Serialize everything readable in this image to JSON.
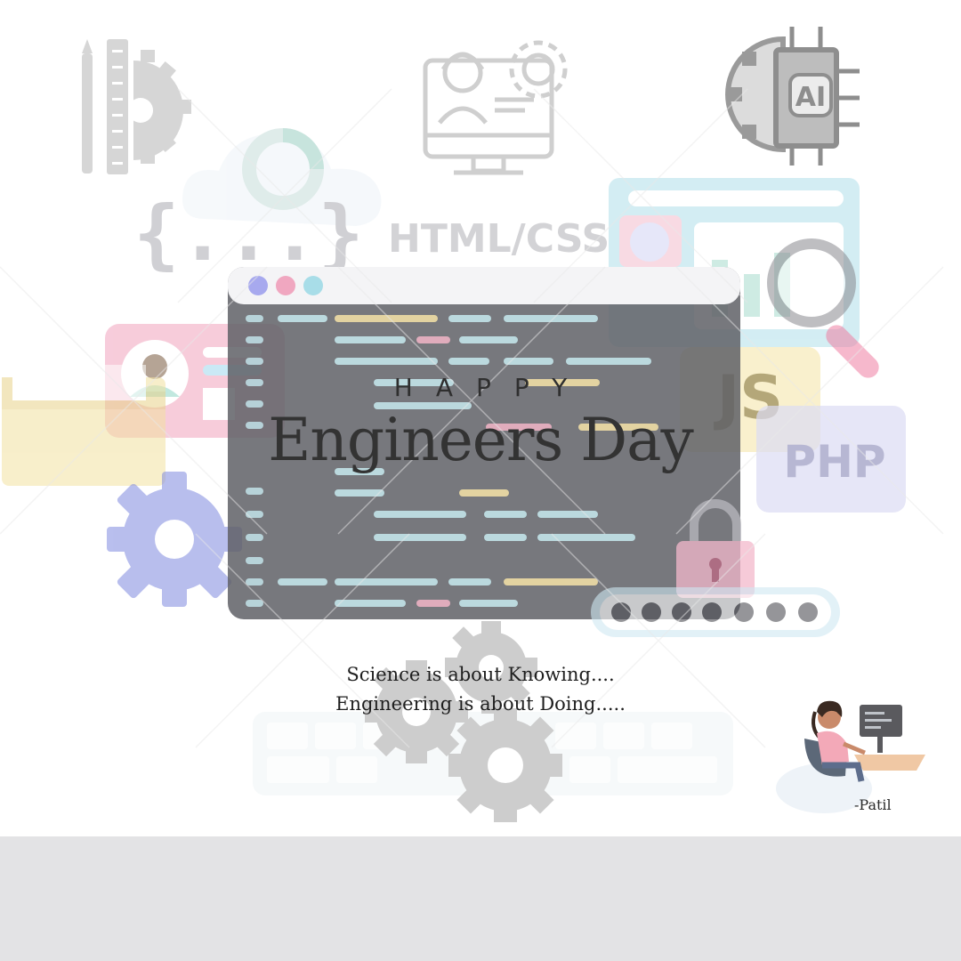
{
  "poster": {
    "greeting": "HAPPY",
    "title": "Engineers Day",
    "quote_line_1": "Science is about Knowing....",
    "quote_line_2": "Engineering is about Doing.....",
    "signature": "-Patil"
  },
  "background_labels": {
    "html_css": "HTML/CSS",
    "js": "JS",
    "php": "PHP",
    "ai": "AI",
    "braces": "{...}"
  },
  "icons": [
    "pencil-ruler-gear-icon",
    "engineer-monitor-gear-icon",
    "ai-chip-gear-icon",
    "cloud-chart-icon",
    "code-editor-window",
    "dashboard-window-icon",
    "magnifier-icon",
    "profile-card-icon",
    "folder-icon",
    "gear-icon",
    "lock-icon",
    "password-dots-icon",
    "keyboard-icon",
    "cogs-icon",
    "woman-at-computer-illustration"
  ],
  "colors": {
    "background": "#ffffff",
    "bottom_band": "#e3e3e5",
    "title_text": "#333333",
    "editor_dark": "#5a5b60"
  }
}
